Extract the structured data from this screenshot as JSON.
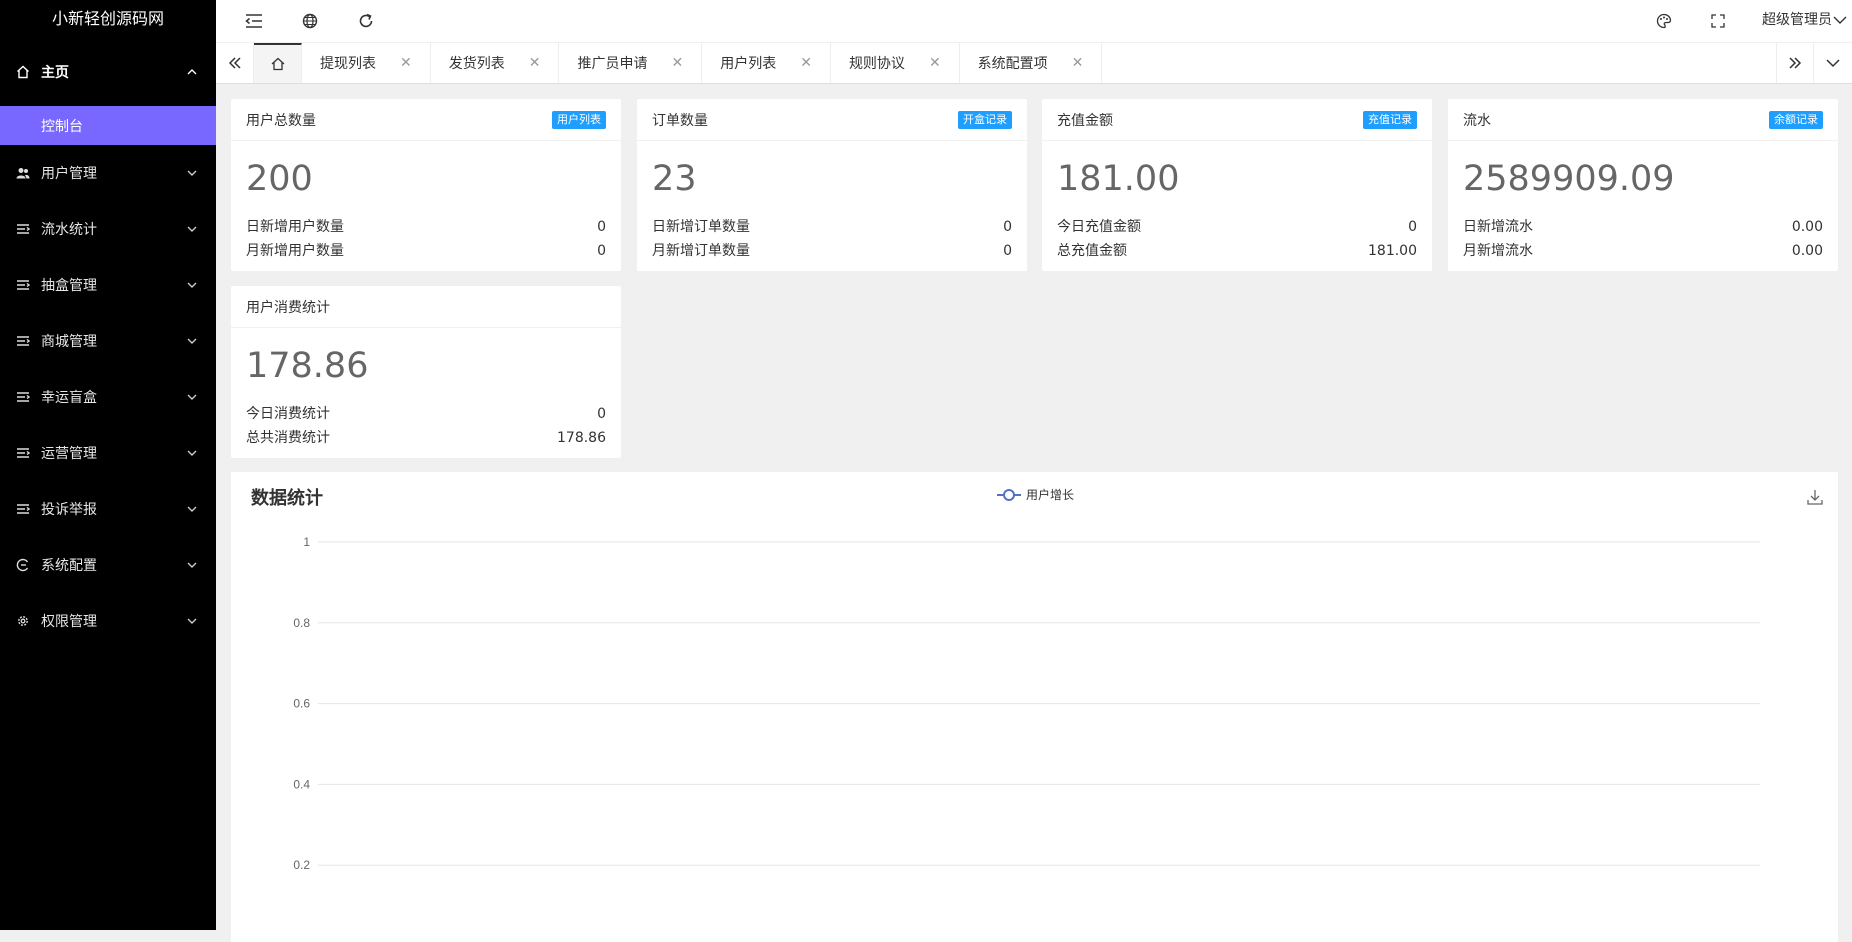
{
  "app": {
    "logo": "小新轻创源码网"
  },
  "sidebar": {
    "items": [
      {
        "label": "主页",
        "icon": "home-icon"
      },
      {
        "label": "用户管理",
        "icon": "users-icon"
      },
      {
        "label": "流水统计",
        "icon": "list-icon"
      },
      {
        "label": "抽盒管理",
        "icon": "list-icon"
      },
      {
        "label": "商城管理",
        "icon": "list-icon"
      },
      {
        "label": "幸运盲盒",
        "icon": "list-icon"
      },
      {
        "label": "运营管理",
        "icon": "list-icon"
      },
      {
        "label": "投诉举报",
        "icon": "list-icon"
      },
      {
        "label": "系统配置",
        "icon": "cog-icon"
      },
      {
        "label": "权限管理",
        "icon": "gear-icon"
      }
    ],
    "active_sub": "控制台"
  },
  "header": {
    "user": "超级管理员"
  },
  "tabs": [
    {
      "label": "提现列表"
    },
    {
      "label": "发货列表"
    },
    {
      "label": "推广员申请"
    },
    {
      "label": "用户列表"
    },
    {
      "label": "规则协议"
    },
    {
      "label": "系统配置项"
    }
  ],
  "cards": [
    {
      "title": "用户总数量",
      "badge": "用户列表",
      "value": "200",
      "rows": [
        {
          "label": "日新增用户数量",
          "value": "0"
        },
        {
          "label": "月新增用户数量",
          "value": "0"
        }
      ]
    },
    {
      "title": "订单数量",
      "badge": "开盒记录",
      "value": "23",
      "rows": [
        {
          "label": "日新增订单数量",
          "value": "0"
        },
        {
          "label": "月新增订单数量",
          "value": "0"
        }
      ]
    },
    {
      "title": "充值金额",
      "badge": "充值记录",
      "value": "181.00",
      "rows": [
        {
          "label": "今日充值金额",
          "value": "0"
        },
        {
          "label": "总充值金额",
          "value": "181.00"
        }
      ]
    },
    {
      "title": "流水",
      "badge": "余额记录",
      "value": "2589909.09",
      "rows": [
        {
          "label": "日新增流水",
          "value": "0.00"
        },
        {
          "label": "月新增流水",
          "value": "0.00"
        }
      ]
    },
    {
      "title": "用户消费统计",
      "badge": "",
      "value": "178.86",
      "rows": [
        {
          "label": "今日消费统计",
          "value": "0"
        },
        {
          "label": "总共消费统计",
          "value": "178.86"
        }
      ]
    }
  ],
  "panel": {
    "title": "数据统计"
  },
  "chart_data": {
    "type": "line",
    "title": "",
    "series": [
      {
        "name": "用户增长",
        "values": []
      }
    ],
    "yticks": [
      "1",
      "0.8",
      "0.6",
      "0.4",
      "0.2"
    ],
    "ylim": [
      0,
      1
    ],
    "grid": true,
    "legend": "top-center",
    "color": "#5470c6"
  }
}
